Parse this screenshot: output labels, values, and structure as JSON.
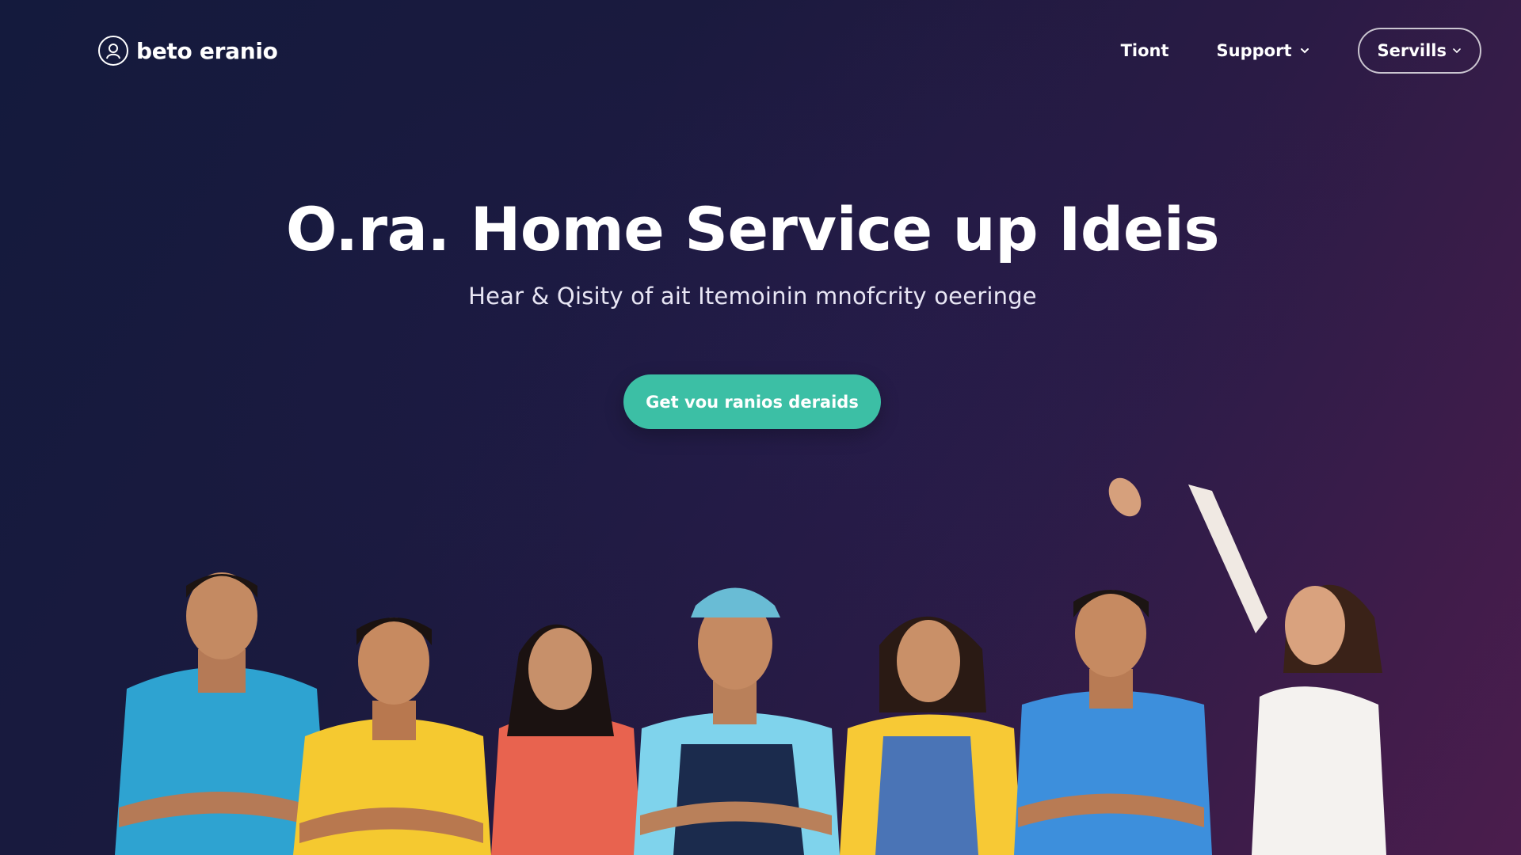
{
  "header": {
    "brand_name": "beto eranio",
    "nav": {
      "item1_label": "Tiont",
      "item2_label": "Support",
      "button_label": "Servills"
    }
  },
  "hero": {
    "title": "O.ra. Home Service up Ideis",
    "subtitle": "Hear & Qisity of ait Itemoinin mnofcrity oeeringe",
    "cta_label": "Get vou ranios deraids"
  },
  "colors": {
    "accent": "#3cbfa5",
    "background_start": "#141a3d",
    "background_end": "#4b1d4d"
  },
  "illustration": {
    "people_shirt_colors": [
      "#2ea3d1",
      "#f5c930",
      "#e8634f",
      "#7fd3ec",
      "#f7c935",
      "#3d8fdc",
      "#f4f2ef"
    ]
  }
}
